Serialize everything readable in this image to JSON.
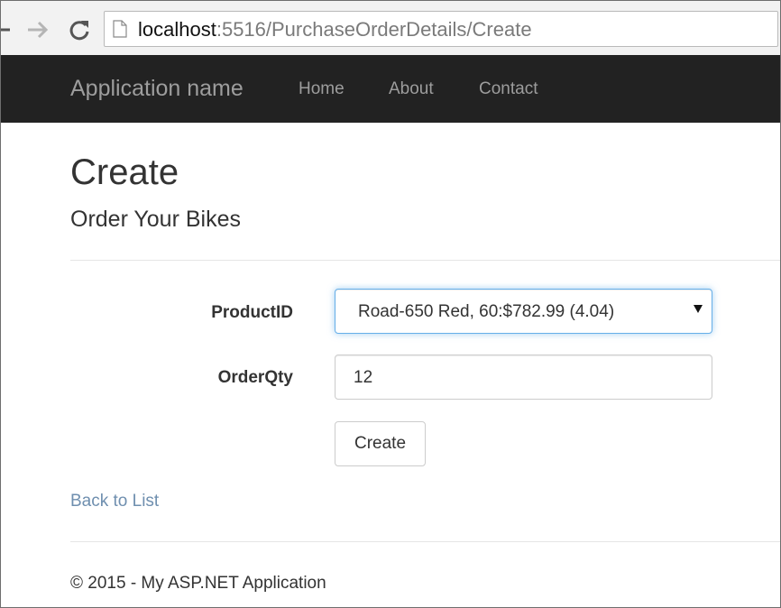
{
  "browser": {
    "url_host": "localhost",
    "url_rest": ":5516/PurchaseOrderDetails/Create",
    "icons": [
      "back-arrow-icon",
      "forward-arrow-icon",
      "reload-icon",
      "page-icon"
    ]
  },
  "navbar": {
    "brand": "Application name",
    "links": [
      "Home",
      "About",
      "Contact"
    ],
    "background": "#222222",
    "link_color": "#9d9d9d"
  },
  "page": {
    "title": "Create",
    "subtitle": "Order Your Bikes"
  },
  "form": {
    "product_label": "ProductID",
    "product_selected": "Road-650 Red, 60:$782.99 (4.04)",
    "qty_label": "OrderQty",
    "qty_value": "12",
    "submit_label": "Create"
  },
  "back_link": "Back to List",
  "footer": "© 2015 - My ASP.NET Application",
  "colors": {
    "link": "#6f8faf",
    "focus_border": "#66afe9"
  }
}
